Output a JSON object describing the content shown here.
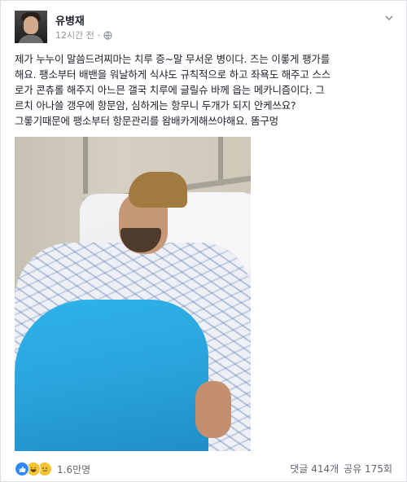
{
  "post": {
    "author": "유병재",
    "time": "12시간 전",
    "privacy_icon": "globe-icon",
    "menu_icon": "chevron-down-icon",
    "lines": [
      "제가 누누이 말씀드려찌마는 치루 증~말 무서운 병이다. 즈는 이롷게 팽가를",
      "해요. 팽소부터 배밴을 워날하게 식샤도 규칙적으로 하고 좌욕도 해주고 스스",
      "로가 콘츄롤 해주지 아느믄 갤국 치루에 글릴슈 바께 읍는 메카니즘이다. 그",
      "르치 아나쓸 갱우에 항문암, 심하게는 항무니 두개가 되지 안케쓰요?",
      "그롷기때문에 팽소부터 항문관리를 왐배카게해쓰야해요. 똠구멍"
    ],
    "photo_alt": "hospital-bed-photo"
  },
  "footer": {
    "reaction_icons": [
      "like-icon",
      "haha-icon",
      "sad-icon"
    ],
    "reaction_count": "1.6만명",
    "comments": "댓글 414개",
    "shares": "공유 175회"
  }
}
